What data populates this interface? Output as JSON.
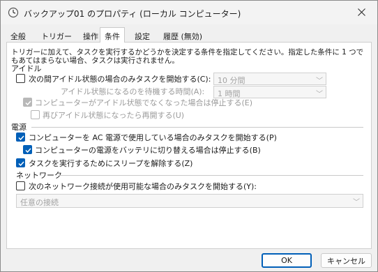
{
  "window": {
    "title": "バックアップ01 のプロパティ (ローカル コンピューター)"
  },
  "tabs": [
    {
      "label": "全般"
    },
    {
      "label": "トリガー"
    },
    {
      "label": "操作"
    },
    {
      "label": "条件",
      "active": true
    },
    {
      "label": "設定"
    },
    {
      "label": "履歴 (無効)"
    }
  ],
  "description": "トリガーに加えて、タスクを実行するかどうかを決定する条件を指定してください。指定した条件に 1 つでもあてはまらない場合、タスクは実行されません。",
  "idle": {
    "group_label": "アイドル",
    "start_only_idle": {
      "label": "次の間アイドル状態の場合のみタスクを開始する(C):",
      "checked": false
    },
    "idle_duration": {
      "value": "10 分間"
    },
    "wait_label": "アイドル状態になるのを待機する時間(A):",
    "wait_duration": {
      "value": "1 時間"
    },
    "stop_if_not_idle": {
      "label": "コンピューターがアイドル状態でなくなった場合は停止する(E)",
      "checked": true,
      "disabled": true
    },
    "restart_if_idle": {
      "label": "再びアイドル状態になったら再開する(U)",
      "checked": false,
      "disabled": true
    }
  },
  "power": {
    "group_label": "電源",
    "ac_only": {
      "label": "コンピューターを AC 電源で使用している場合のみタスクを開始する(P)",
      "checked": true
    },
    "stop_on_battery": {
      "label": "コンピューターの電源をバッテリに切り替える場合は停止する(B)",
      "checked": true
    },
    "wake_to_run": {
      "label": "タスクを実行するためにスリープを解除する(Z)",
      "checked": true
    }
  },
  "network": {
    "group_label": "ネットワーク",
    "network_only": {
      "label": "次のネットワーク接続が使用可能な場合のみタスクを開始する(Y):",
      "checked": false
    },
    "connection": {
      "value": "任意の接続"
    }
  },
  "buttons": {
    "ok": "OK",
    "cancel": "キャンセル"
  },
  "colors": {
    "accent": "#005fb8",
    "disabled_text": "#9a9a9a"
  }
}
